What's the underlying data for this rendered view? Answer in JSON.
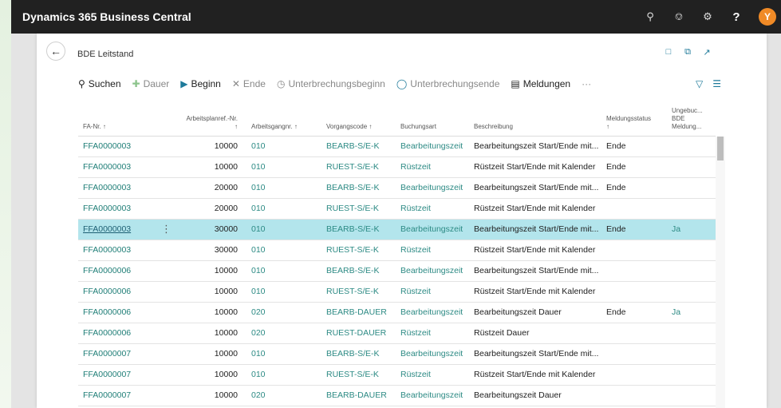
{
  "app": {
    "title": "Dynamics 365 Business Central",
    "avatar_letter": "Y"
  },
  "page": {
    "title": "BDE Leitstand"
  },
  "actions": {
    "search": "Suchen",
    "dauer": "Dauer",
    "beginn": "Beginn",
    "ende": "Ende",
    "unterbrechungsbeginn": "Unterbrechungsbeginn",
    "unterbrechungsende": "Unterbrechungsende",
    "meldungen": "Meldungen",
    "more": "···"
  },
  "columns": {
    "fa_nr": "FA-Nr. ↑",
    "arbeitsplanref_1": "Arbeitsplanref.-Nr.",
    "arbeitsplanref_2": "↑",
    "arbeitsgangnr": "Arbeitsgangnr. ↑",
    "vorgangscode": "Vorgangscode ↑",
    "buchungsart": "Buchungsart",
    "beschreibung": "Beschreibung",
    "meldungsstatus_1": "Meldungsstatus",
    "meldungsstatus_2": "↑",
    "ungebucht_1": "Ungebuc...",
    "ungebucht_2": "BDE",
    "ungebucht_3": "Meldung..."
  },
  "rows": [
    {
      "fa": "FFA0000003",
      "ref": "10000",
      "ag": "010",
      "code": "BEARB-S/E-K",
      "art": "Bearbeitungszeit",
      "desc": "Bearbeitungszeit Start/Ende mit...",
      "status": "Ende",
      "ungebucht": ""
    },
    {
      "fa": "FFA0000003",
      "ref": "10000",
      "ag": "010",
      "code": "RUEST-S/E-K",
      "art": "Rüstzeit",
      "desc": "Rüstzeit Start/Ende mit Kalender",
      "status": "Ende",
      "ungebucht": ""
    },
    {
      "fa": "FFA0000003",
      "ref": "20000",
      "ag": "010",
      "code": "BEARB-S/E-K",
      "art": "Bearbeitungszeit",
      "desc": "Bearbeitungszeit Start/Ende mit...",
      "status": "Ende",
      "ungebucht": ""
    },
    {
      "fa": "FFA0000003",
      "ref": "20000",
      "ag": "010",
      "code": "RUEST-S/E-K",
      "art": "Rüstzeit",
      "desc": "Rüstzeit Start/Ende mit Kalender",
      "status": "",
      "ungebucht": ""
    },
    {
      "fa": "FFA0000003",
      "ref": "30000",
      "ag": "010",
      "code": "BEARB-S/E-K",
      "art": "Bearbeitungszeit",
      "desc": "Bearbeitungszeit Start/Ende mit...",
      "status": "Ende",
      "ungebucht": "Ja"
    },
    {
      "fa": "FFA0000003",
      "ref": "30000",
      "ag": "010",
      "code": "RUEST-S/E-K",
      "art": "Rüstzeit",
      "desc": "Rüstzeit Start/Ende mit Kalender",
      "status": "",
      "ungebucht": ""
    },
    {
      "fa": "FFA0000006",
      "ref": "10000",
      "ag": "010",
      "code": "BEARB-S/E-K",
      "art": "Bearbeitungszeit",
      "desc": "Bearbeitungszeit Start/Ende mit...",
      "status": "",
      "ungebucht": ""
    },
    {
      "fa": "FFA0000006",
      "ref": "10000",
      "ag": "010",
      "code": "RUEST-S/E-K",
      "art": "Rüstzeit",
      "desc": "Rüstzeit Start/Ende mit Kalender",
      "status": "",
      "ungebucht": ""
    },
    {
      "fa": "FFA0000006",
      "ref": "10000",
      "ag": "020",
      "code": "BEARB-DAUER",
      "art": "Bearbeitungszeit",
      "desc": "Bearbeitungszeit Dauer",
      "status": "Ende",
      "ungebucht": "Ja"
    },
    {
      "fa": "FFA0000006",
      "ref": "10000",
      "ag": "020",
      "code": "RUEST-DAUER",
      "art": "Rüstzeit",
      "desc": "Rüstzeit Dauer",
      "status": "",
      "ungebucht": ""
    },
    {
      "fa": "FFA0000007",
      "ref": "10000",
      "ag": "010",
      "code": "BEARB-S/E-K",
      "art": "Bearbeitungszeit",
      "desc": "Bearbeitungszeit Start/Ende mit...",
      "status": "",
      "ungebucht": ""
    },
    {
      "fa": "FFA0000007",
      "ref": "10000",
      "ag": "010",
      "code": "RUEST-S/E-K",
      "art": "Rüstzeit",
      "desc": "Rüstzeit Start/Ende mit Kalender",
      "status": "",
      "ungebucht": ""
    },
    {
      "fa": "FFA0000007",
      "ref": "10000",
      "ag": "020",
      "code": "BEARB-DAUER",
      "art": "Bearbeitungszeit",
      "desc": "Bearbeitungszeit Dauer",
      "status": "",
      "ungebucht": ""
    }
  ],
  "selected_row": 4,
  "colors": {
    "accent": "#1e7a9a",
    "selected_row": "#b3e5ec",
    "top_bar": "#212121",
    "avatar": "#f08a26"
  }
}
